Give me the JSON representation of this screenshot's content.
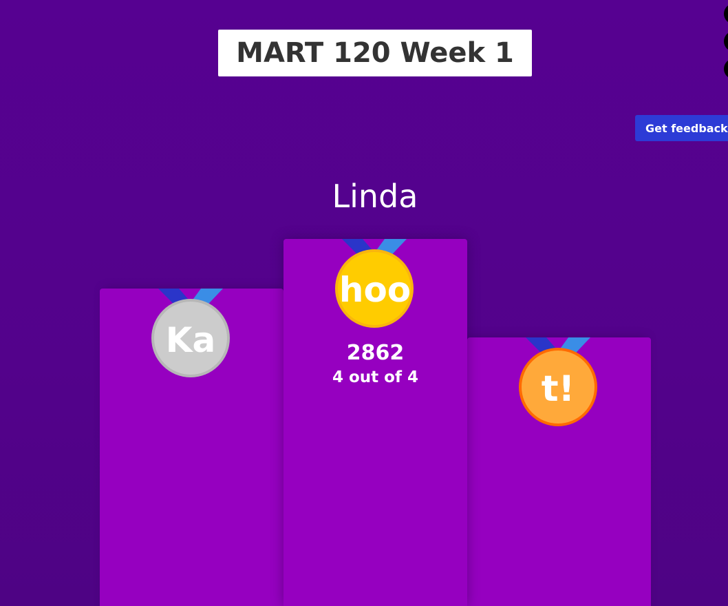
{
  "header": {
    "title": "MART 120 Week 1"
  },
  "actions": {
    "feedback_label": "Get feedback"
  },
  "colors": {
    "background": "#520188",
    "podium": "#9600c0",
    "feedback_button": "#2d3bd6",
    "gold": "#ffcc00",
    "silver": "#cccccc",
    "bronze": "#ffa93a"
  },
  "podium": {
    "first": {
      "name": "Linda",
      "score": "2862",
      "correct": "4 out of 4",
      "medal": {
        "icon": "gold-medal-icon",
        "letters": "hoo"
      }
    },
    "second": {
      "medal": {
        "icon": "silver-medal-icon",
        "letters": "Ka"
      }
    },
    "third": {
      "medal": {
        "icon": "bronze-medal-icon",
        "letters": "t!"
      }
    }
  }
}
